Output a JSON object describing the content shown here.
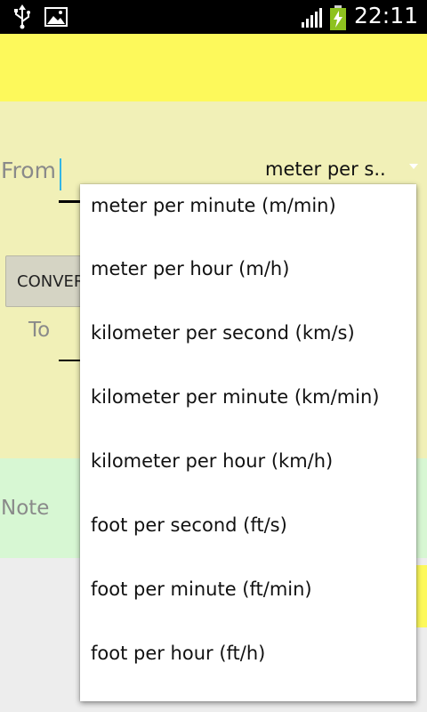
{
  "status_bar": {
    "time": "22:11",
    "icons": [
      "usb-icon",
      "image-icon",
      "signal-icon",
      "battery-charging-icon"
    ]
  },
  "converter": {
    "from_label": "From",
    "from_unit_selected": "meter per s..",
    "convert_button_label": "CONVERT",
    "to_label": "To"
  },
  "note": {
    "label": "Note"
  },
  "dropdown": {
    "options": [
      "meter per minute (m/min)",
      "meter per hour (m/h)",
      "kilometer per second (km/s)",
      "kilometer per minute (km/min)",
      "kilometer per hour (km/h)",
      "foot per second (ft/s)",
      "foot per minute (ft/min)",
      "foot per hour (ft/h)"
    ]
  },
  "colors": {
    "header": "#fdf95b",
    "converter_bg": "#f1f0b7",
    "note_bg": "#d7f7d3",
    "cursor": "#33b5e5"
  }
}
